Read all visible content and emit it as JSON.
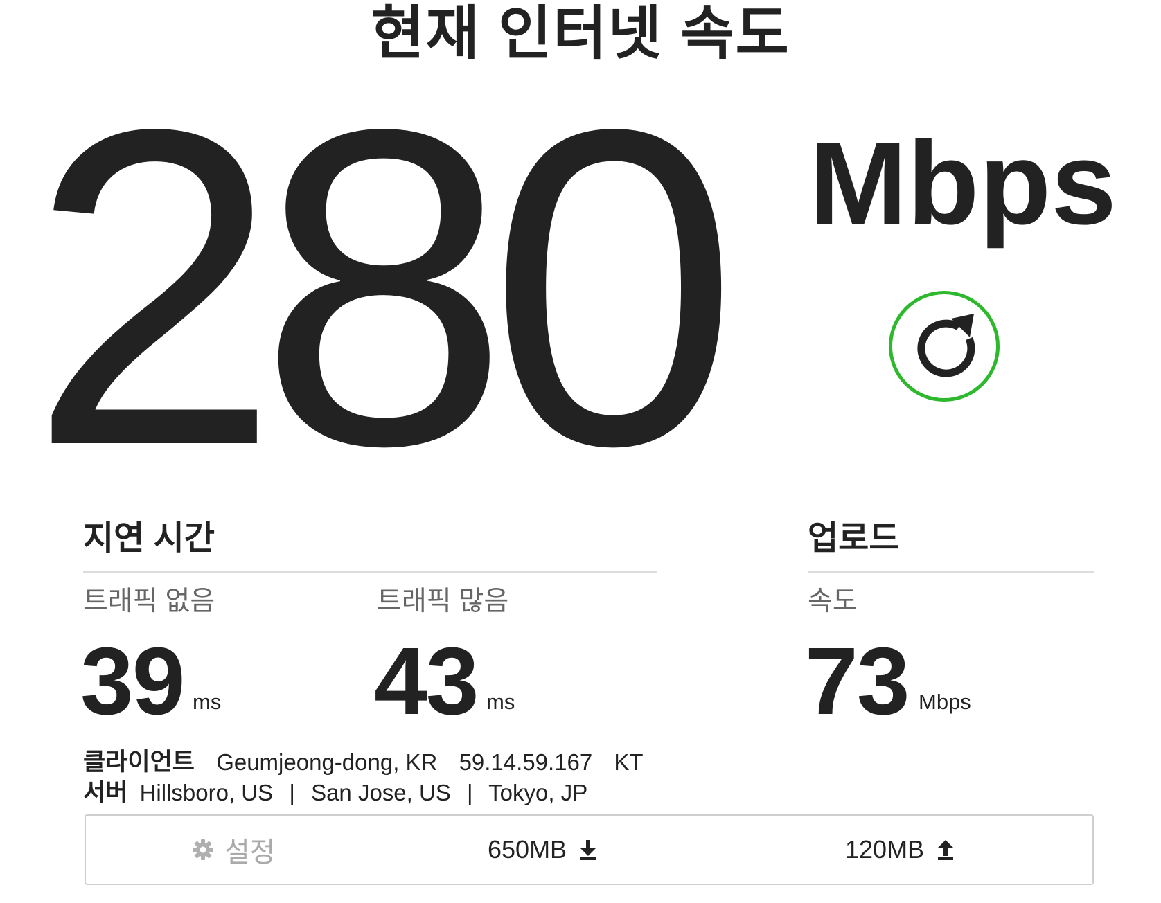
{
  "header": {
    "title": "현재 인터넷 속도"
  },
  "download": {
    "value": "280",
    "unit": "Mbps"
  },
  "refresh": {
    "icon": "refresh-icon",
    "accent_color": "#2db82d"
  },
  "latency": {
    "heading": "지연 시간",
    "unloaded": {
      "label": "트래픽 없음",
      "value": "39",
      "unit": "ms"
    },
    "loaded": {
      "label": "트래픽 많음",
      "value": "43",
      "unit": "ms"
    }
  },
  "upload": {
    "heading": "업로드",
    "speed": {
      "label": "속도",
      "value": "73",
      "unit": "Mbps"
    }
  },
  "client": {
    "label": "클라이언트",
    "location": "Geumjeong-dong, KR",
    "ip": "59.14.59.167",
    "isp": "KT"
  },
  "server": {
    "label": "서버",
    "locations": [
      "Hillsboro, US",
      "San Jose, US",
      "Tokyo, JP"
    ],
    "separator": "|"
  },
  "toolbar": {
    "settings_label": "설정",
    "download_size": "650MB",
    "upload_size": "120MB"
  },
  "icons": [
    "refresh-icon",
    "gear-icon",
    "download-arrow-icon",
    "upload-arrow-icon"
  ]
}
